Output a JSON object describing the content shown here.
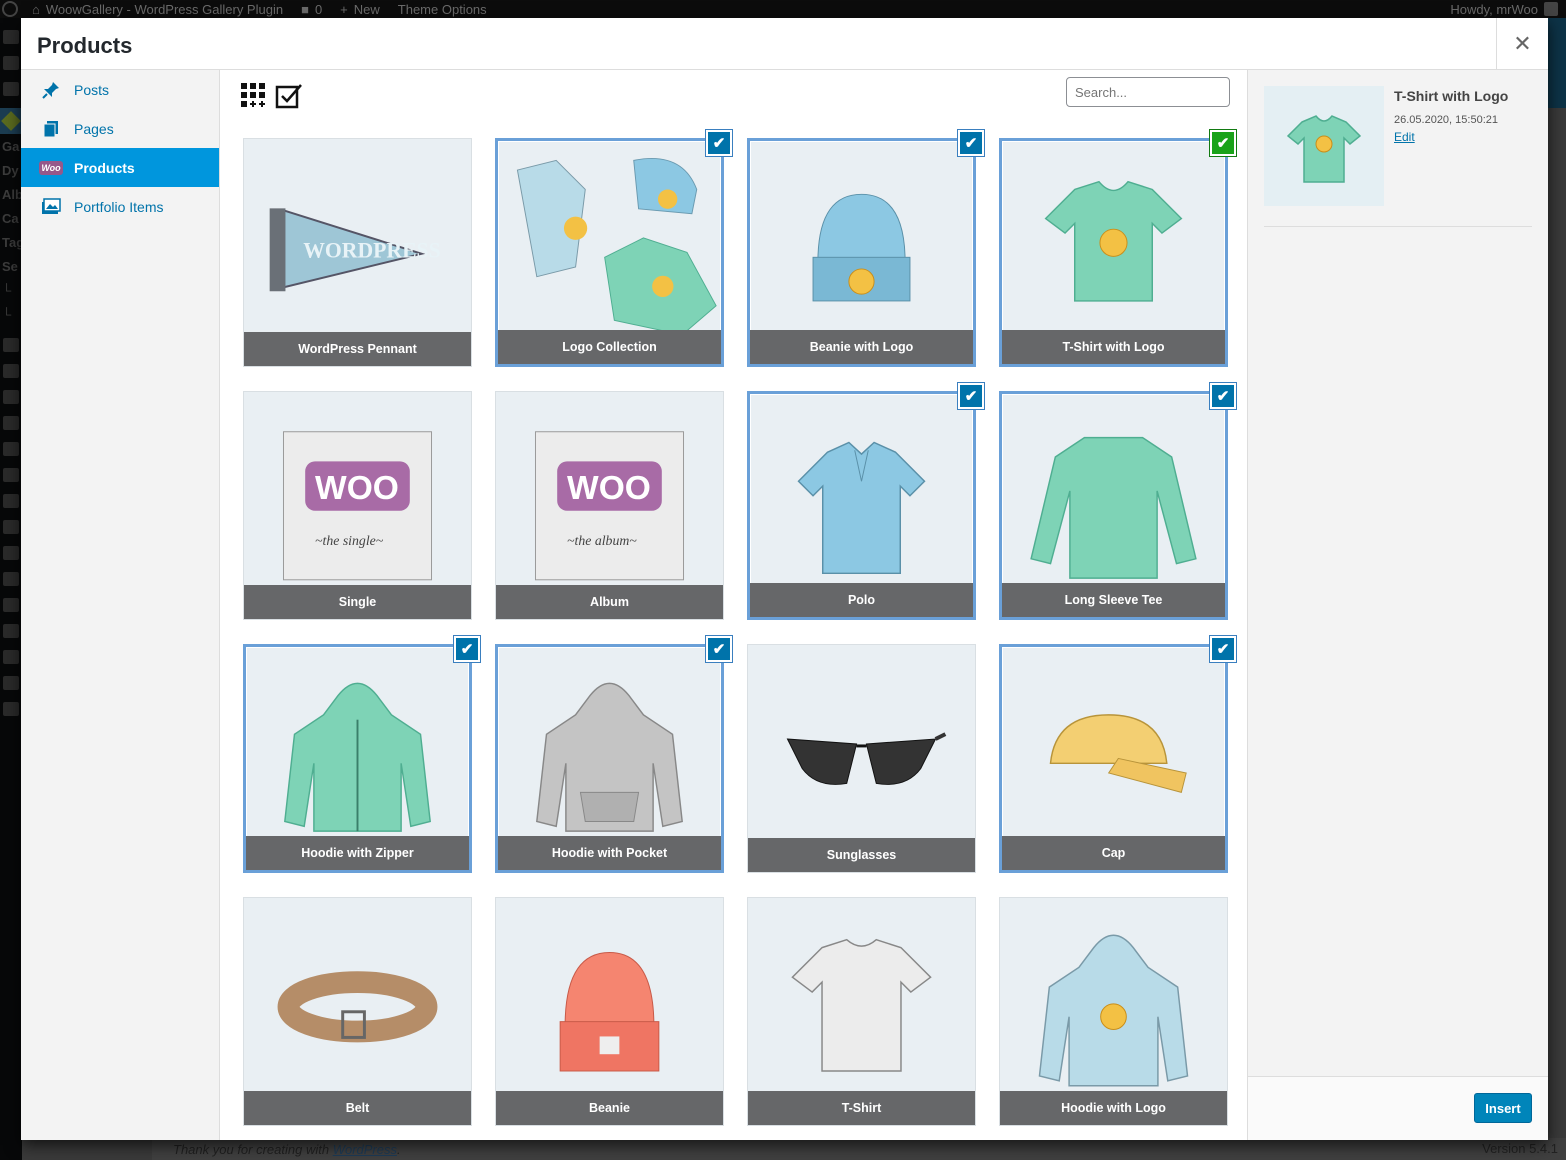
{
  "admin_bar": {
    "site_name": "WoowGallery - WordPress Gallery Plugin",
    "comments_count": "0",
    "new_label": "New",
    "theme_options_label": "Theme Options",
    "greeting": "Howdy, mrWoo"
  },
  "admin_menu": {
    "partial_labels": [
      "Ga",
      "Dy",
      "Alb",
      "Ca",
      "Tag",
      "Se",
      "└",
      "└"
    ]
  },
  "footer": {
    "thanks_prefix": "Thank you for creating with ",
    "thanks_link": "WordPress",
    "thanks_suffix": ".",
    "version": "Version 5.4.1"
  },
  "modal": {
    "title": "Products",
    "close_icon": "✕"
  },
  "menu": {
    "items": [
      {
        "label": "Posts",
        "icon": "pin-icon",
        "active": false
      },
      {
        "label": "Pages",
        "icon": "pages-icon",
        "active": false
      },
      {
        "label": "Products",
        "icon": "woo-icon",
        "badge": "Woo",
        "active": true
      },
      {
        "label": "Portfolio Items",
        "icon": "portfolio-icon",
        "active": false
      }
    ]
  },
  "toolbar": {
    "search_placeholder": "Search..."
  },
  "grid": {
    "items": [
      {
        "label": "WordPress Pennant",
        "selected": false,
        "current": false,
        "art": "pennant"
      },
      {
        "label": "Logo Collection",
        "selected": true,
        "current": false,
        "art": "collection"
      },
      {
        "label": "Beanie with Logo",
        "selected": true,
        "current": false,
        "art": "beanie-logo"
      },
      {
        "label": "T-Shirt with Logo",
        "selected": true,
        "current": true,
        "art": "tshirt-logo"
      },
      {
        "label": "Single",
        "selected": false,
        "current": false,
        "art": "single"
      },
      {
        "label": "Album",
        "selected": false,
        "current": false,
        "art": "album"
      },
      {
        "label": "Polo",
        "selected": true,
        "current": false,
        "art": "polo"
      },
      {
        "label": "Long Sleeve Tee",
        "selected": true,
        "current": false,
        "art": "longsleeve"
      },
      {
        "label": "Hoodie with Zipper",
        "selected": true,
        "current": false,
        "art": "hoodie-zip"
      },
      {
        "label": "Hoodie with Pocket",
        "selected": true,
        "current": false,
        "art": "hoodie-pocket"
      },
      {
        "label": "Sunglasses",
        "selected": false,
        "current": false,
        "art": "sunglasses"
      },
      {
        "label": "Cap",
        "selected": true,
        "current": false,
        "art": "cap"
      },
      {
        "label": "Belt",
        "selected": false,
        "current": false,
        "art": "belt"
      },
      {
        "label": "Beanie",
        "selected": false,
        "current": false,
        "art": "beanie"
      },
      {
        "label": "T-Shirt",
        "selected": false,
        "current": false,
        "art": "tshirt"
      },
      {
        "label": "Hoodie with Logo",
        "selected": false,
        "current": false,
        "art": "hoodie-logo"
      }
    ],
    "check_glyph": "✔"
  },
  "details": {
    "title": "T-Shirt with Logo",
    "date": "26.05.2020, 15:50:21",
    "edit_label": "Edit"
  },
  "footer_actions": {
    "insert_label": "Insert"
  }
}
